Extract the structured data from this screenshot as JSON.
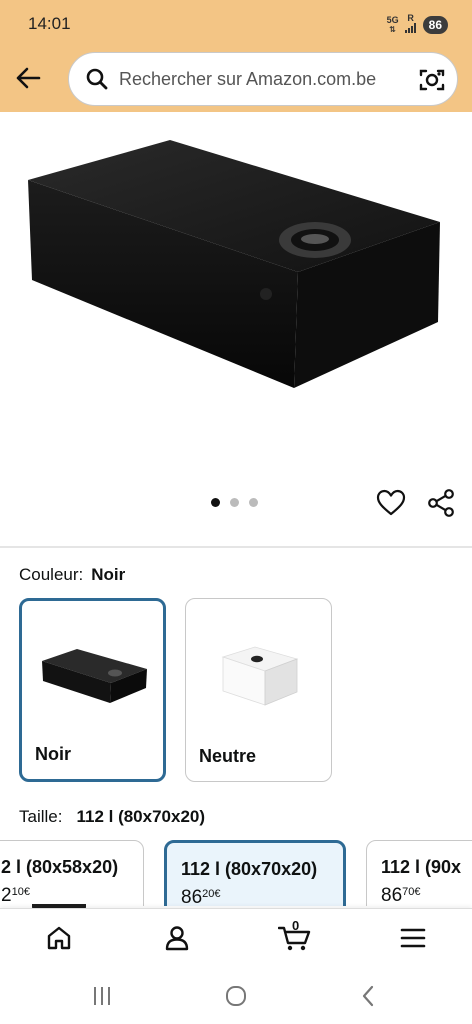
{
  "status_bar": {
    "time": "14:01",
    "network": "5G",
    "signal": "R",
    "battery": "86"
  },
  "header": {
    "search_placeholder": "Rechercher sur Amazon.com.be"
  },
  "gallery": {
    "image_count": 3,
    "active_index": 0
  },
  "color_selector": {
    "label": "Couleur:",
    "selected": "Noir",
    "options": [
      {
        "name": "Noir",
        "swatch_color": "#161616"
      },
      {
        "name": "Neutre",
        "swatch_color": "#f2f2f2"
      }
    ]
  },
  "size_selector": {
    "label": "Taille:",
    "selected": "112 l (80x70x20)",
    "options": [
      {
        "size": "2 l (80x58x20)",
        "price_whole": "2",
        "price_fraction": "10",
        "currency": "€"
      },
      {
        "size": "112 l (80x70x20)",
        "price_whole": "86",
        "price_fraction": "20",
        "currency": "€"
      },
      {
        "size": "112 l (90x",
        "price_whole": "86",
        "price_fraction": "70",
        "currency": "€"
      }
    ]
  },
  "bottom_nav": {
    "cart_count": "0"
  },
  "colors": {
    "header_bg": "#f3c585",
    "selected_border": "#2e6a94",
    "selected_bg": "#eaf4fb"
  }
}
